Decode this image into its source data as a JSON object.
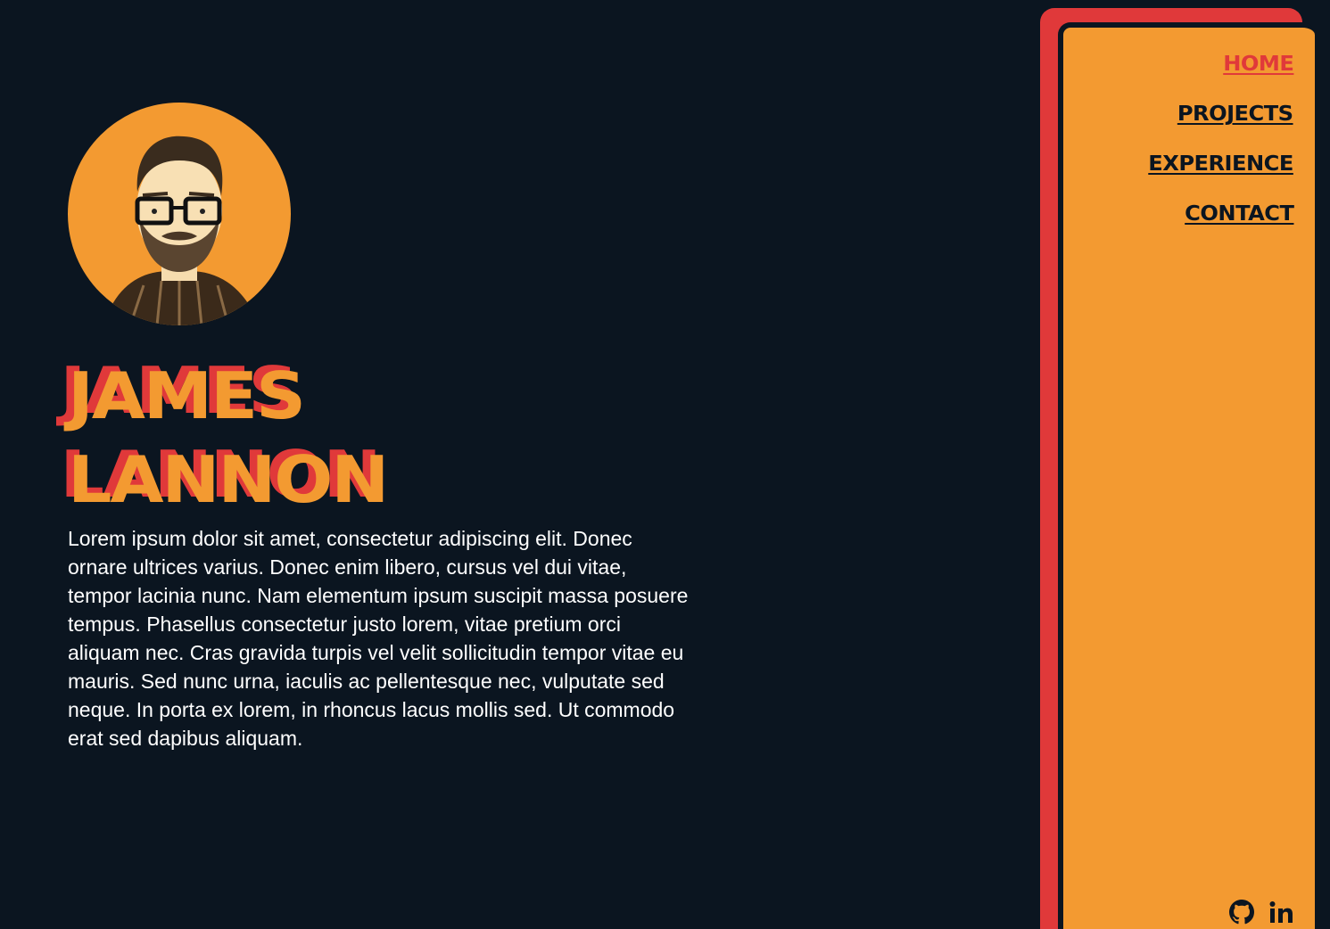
{
  "profile": {
    "first_name": "JAMES",
    "last_name": "LANNON",
    "bio": "Lorem ipsum dolor sit amet, consectetur adipiscing elit. Donec ornare ultrices varius. Donec enim libero, cursus vel dui vitae, tempor lacinia nunc. Nam elementum ipsum suscipit massa posuere tempus. Phasellus consectetur justo lorem, vitae pretium orci aliquam nec. Cras gravida turpis vel velit sollicitudin tempor vitae eu mauris. Sed nunc urna, iaculis ac pellentesque nec, vulputate sed neque. In porta ex lorem, in rhoncus lacus mollis sed. Ut commodo erat sed dapibus aliquam.",
    "avatar_icon": "portrait-illustration"
  },
  "nav": {
    "items": [
      {
        "label": "HOME",
        "active": true
      },
      {
        "label": "PROJECTS",
        "active": false
      },
      {
        "label": "EXPERIENCE",
        "active": false
      },
      {
        "label": "CONTACT",
        "active": false
      }
    ]
  },
  "social": {
    "items": [
      {
        "icon": "github-icon"
      },
      {
        "icon": "linkedin-icon"
      }
    ]
  },
  "colors": {
    "background": "#0b1520",
    "accent_orange": "#f39a31",
    "accent_red": "#e0393a",
    "text_light": "#ffffff"
  }
}
